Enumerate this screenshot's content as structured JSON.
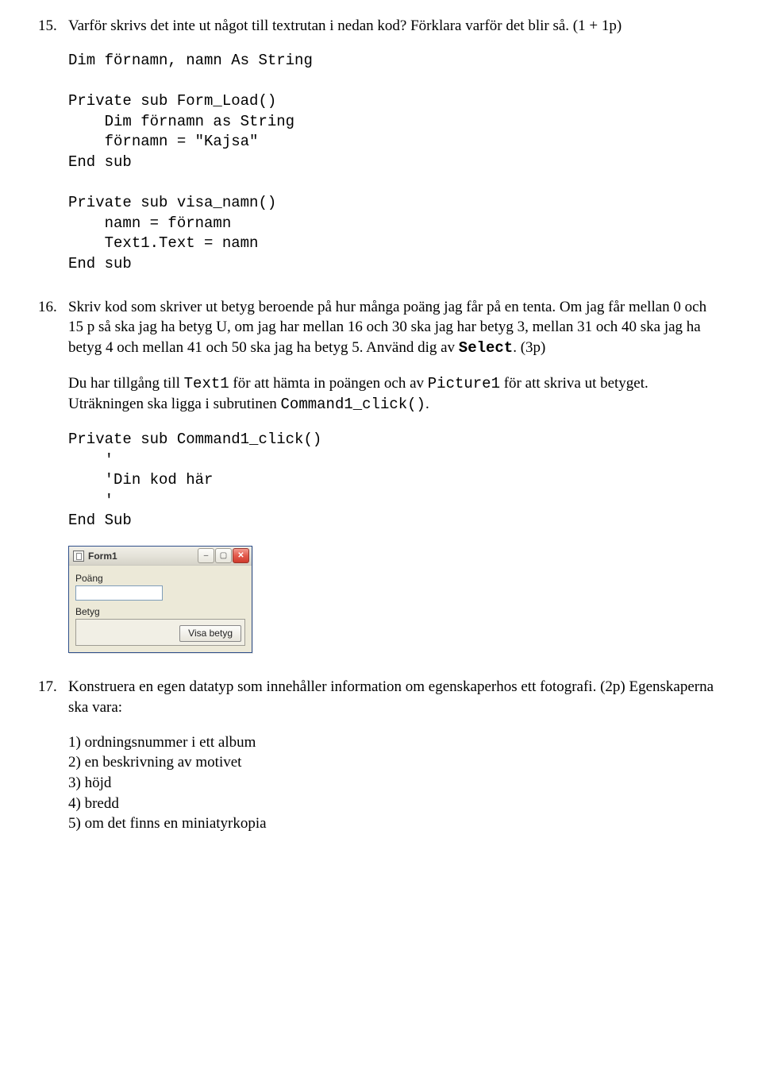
{
  "q15": {
    "num": "15.",
    "text": "Varför skrivs det inte ut något till textrutan i nedan kod? Förklara varför det blir så. (1 + 1p)",
    "code": "Dim förnamn, namn As String\n\nPrivate sub Form_Load()\n    Dim förnamn as String\n    förnamn = \"Kajsa\"\nEnd sub\n\nPrivate sub visa_namn()\n    namn = förnamn\n    Text1.Text = namn\nEnd sub"
  },
  "q16": {
    "num": "16.",
    "para1a": "Skriv kod som skriver ut betyg beroende på hur många poäng jag får på en tenta. Om jag får mellan 0 och 15 p så ska jag ha betyg U, om jag har mellan 16 och 30 ska jag har betyg 3, mellan 31 och 40 ska jag ha betyg 4 och mellan 41 och 50 ska jag ha betyg 5. Använd dig av ",
    "select": "Select",
    "para1b": ". (3p)",
    "para2a": "Du har tillgång till ",
    "t1": "Text1",
    "para2b": " för att hämta in poängen och av ",
    "p1": "Picture1",
    "para2c": " för att skriva ut betyget. Uträkningen ska ligga i subrutinen ",
    "cc": "Command1_click()",
    "para2d": ".",
    "code": "Private sub Command1_click()\n    '\n    'Din kod här\n    '\nEnd Sub",
    "win": {
      "title": "Form1",
      "label1": "Poäng",
      "label2": "Betyg",
      "button": "Visa betyg"
    }
  },
  "q17": {
    "num": "17.",
    "text": "Konstruera en egen datatyp som innehåller information om egenskaperhos ett fotografi. (2p) Egenskaperna ska vara:",
    "items": {
      "i1": "1) ordningsnummer i ett album",
      "i2": "2) en beskrivning av motivet",
      "i3": "3) höjd",
      "i4": "4) bredd",
      "i5": "5) om det finns en miniatyrkopia"
    }
  }
}
